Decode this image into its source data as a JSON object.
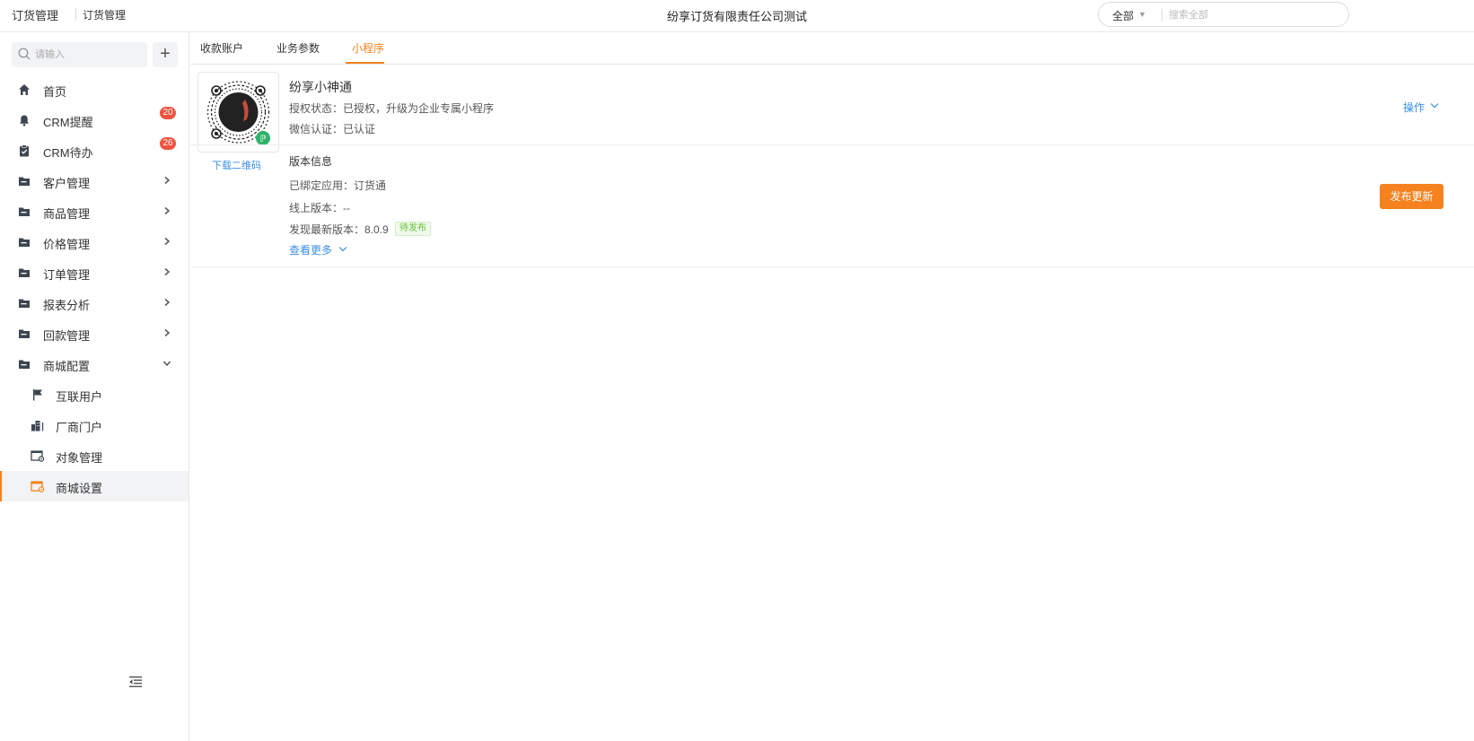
{
  "topbar": {
    "app_title": "订货管理",
    "app_subtitle": "订货管理",
    "company": "纷享订货有限责任公司测试",
    "search_scope": "全部",
    "search_placeholder": "搜索全部"
  },
  "sidebar": {
    "search_placeholder": "请输入",
    "add_label": "+",
    "items": [
      {
        "label": "首页",
        "icon": "home-icon"
      },
      {
        "label": "CRM提醒",
        "icon": "bell-icon",
        "badge": "20"
      },
      {
        "label": "CRM待办",
        "icon": "clipboard-icon",
        "badge": "26"
      },
      {
        "label": "客户管理",
        "icon": "folder-icon"
      },
      {
        "label": "商品管理",
        "icon": "folder-icon"
      },
      {
        "label": "价格管理",
        "icon": "folder-icon"
      },
      {
        "label": "订单管理",
        "icon": "folder-icon"
      },
      {
        "label": "报表分析",
        "icon": "folder-icon"
      },
      {
        "label": "回款管理",
        "icon": "folder-icon"
      },
      {
        "label": "商城配置",
        "icon": "folder-icon",
        "expanded": true
      }
    ],
    "sub_items": [
      {
        "label": "互联用户",
        "icon": "flag-icon"
      },
      {
        "label": "厂商门户",
        "icon": "building-icon"
      },
      {
        "label": "对象管理",
        "icon": "object-settings-icon"
      },
      {
        "label": "商城设置",
        "icon": "mall-settings-icon",
        "active": true
      }
    ]
  },
  "tabs": [
    {
      "label": "收款账户",
      "active": false
    },
    {
      "label": "业务参数",
      "active": false
    },
    {
      "label": "小程序",
      "active": true
    }
  ],
  "miniprogram": {
    "download_qr": "下载二维码",
    "name": "纷享小神通",
    "auth_status": "授权状态：已授权，升级为企业专属小程序",
    "wechat_cert": "微信认证：已认证",
    "action_label": "操作",
    "version": {
      "title": "版本信息",
      "bound_app": "已绑定应用：订货通",
      "online_version": "线上版本：--",
      "latest_version": "发现最新版本：8.0.9",
      "pending_tag": "待发布",
      "more_label": "查看更多",
      "publish_button": "发布更新"
    }
  },
  "colors": {
    "accent": "#f5821f",
    "link": "#3a8ee6",
    "badge": "#f0533e",
    "success": "#67c23a"
  }
}
